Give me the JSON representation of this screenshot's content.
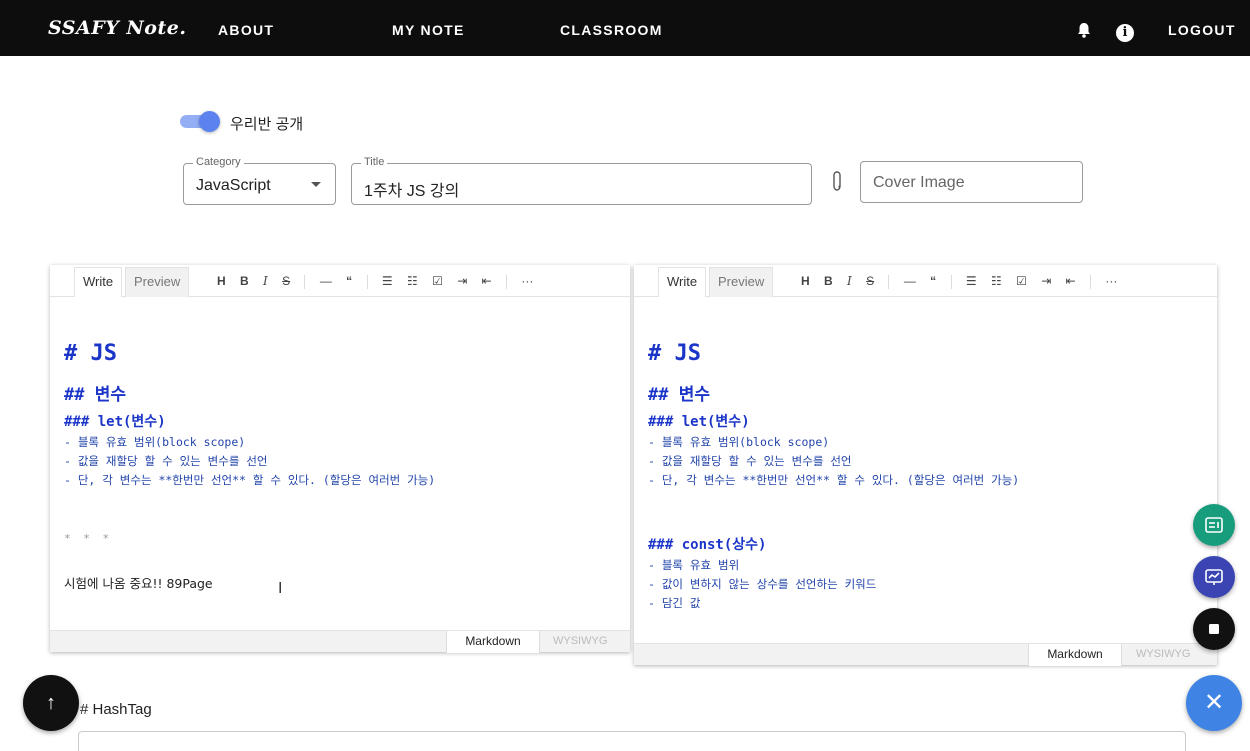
{
  "nav": {
    "logo": "SSAFY Note.",
    "about": "ABOUT",
    "my_note": "MY NOTE",
    "classroom": "CLASSROOM",
    "logout": "LOGOUT",
    "info_glyph": "i"
  },
  "toggle": {
    "label": "우리반 공개",
    "on": true
  },
  "form": {
    "category_legend": "Category",
    "category_value": "JavaScript",
    "title_legend": "Title",
    "title_value": "1주차 JS 강의",
    "cover_placeholder": "Cover Image"
  },
  "editor_tabs": {
    "write": "Write",
    "preview": "Preview"
  },
  "toolbar": {
    "heading": "H",
    "bold": "B",
    "italic": "I",
    "strike": "S",
    "hr": "—",
    "quote": "“",
    "more": "···"
  },
  "editor_left": {
    "h1": "# JS",
    "h2": "## 변수",
    "h3": "### let(변수)",
    "items": [
      "- 블록 유효 범위(block scope)",
      "- 값을 재할당 할 수 있는 변수를 선언",
      "- 단, 각 변수는 **한번만 선언** 할 수 있다. (할당은 여러번 가능)"
    ],
    "hr": "* * *",
    "note": "시험에 나옴 중요!! 89Page"
  },
  "editor_right": {
    "h1": "# JS",
    "h2": "## 변수",
    "h3": "### let(변수)",
    "items": [
      "- 블록 유효 범위(block scope)",
      "- 값을 재할당 할 수 있는 변수를 선언",
      "- 단, 각 변수는 **한번만 선언** 할 수 있다. (할당은 여러번 가능)"
    ],
    "h3b": "### const(상수)",
    "items2": [
      "- 블록 유효 범위",
      "- 값이 변하지 않는 상수를 선언하는 키워드",
      "- 담긴 값"
    ]
  },
  "editor_footer": {
    "markdown": "Markdown",
    "wysiwyg": "WYSIWYG"
  },
  "hashtag_label": "# HashTag",
  "fab": {
    "close": "✕",
    "up": "↑"
  },
  "colors": {
    "nav_bg": "#0d0d0d",
    "toggle_on": "#5b82ee",
    "markdown_blue": "#1a35c8",
    "fab_green": "#179c7c",
    "fab_indigo": "#3a44b3",
    "fab_blue": "#3f84e5"
  }
}
